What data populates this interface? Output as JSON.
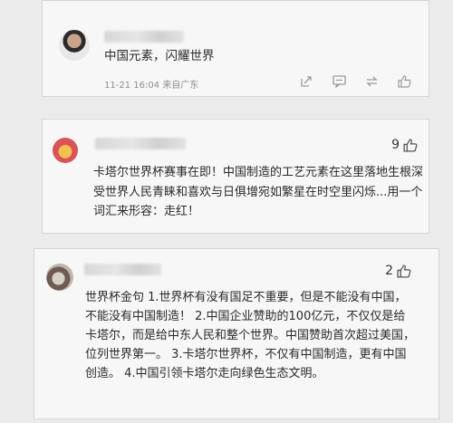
{
  "comments": [
    {
      "text": "中国元素，闪耀世界",
      "time": "11-21 16:04",
      "location": "来自广东",
      "action_icons": [
        "share-icon",
        "comment-icon",
        "repost-icon",
        "like-icon"
      ]
    },
    {
      "text": "卡塔尔世界杯赛事在即！中国制造的工艺元素在这里落地生根深受世界人民青睐和喜欢与日俱增宛如繁星在时空里闪烁...用一个词汇来形容：走红！",
      "likes": "9",
      "like_icon": "thumbs-up-icon"
    },
    {
      "text": "世界杯金句 1.世界杯有没有国足不重要，但是不能没有中国，不能没有中国制造！ 2.中国企业赞助的100亿元，不仅仅是给卡塔尔，而是给中东人民和整个世界。中国赞助首次超过美国，位列世界第一。 3.卡塔尔世界杯，不仅有中国制造，更有中国创造。 4.中国引领卡塔尔走向绿色生态文明。",
      "likes": "2",
      "like_icon": "thumbs-up-icon"
    }
  ]
}
